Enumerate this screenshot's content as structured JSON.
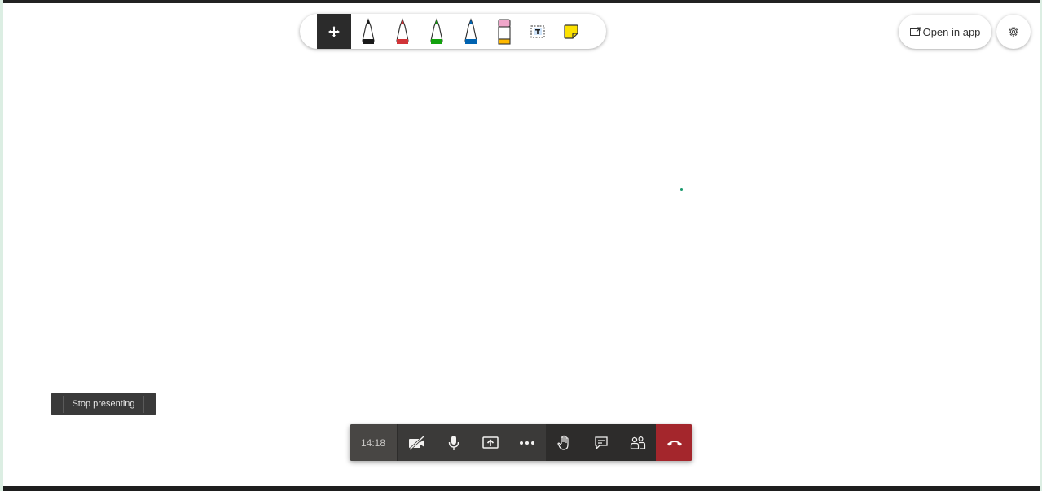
{
  "toolbar": {
    "tools": [
      {
        "name": "move-tool",
        "icon": "move-arrows-icon",
        "active": true
      },
      {
        "name": "black-pen",
        "icon": "pen-icon",
        "color": "#1a1a1a"
      },
      {
        "name": "red-pen",
        "icon": "pen-icon",
        "color": "#d13438"
      },
      {
        "name": "green-pen",
        "icon": "pen-icon",
        "color": "#13a10e"
      },
      {
        "name": "blue-pen",
        "icon": "pen-icon",
        "color": "#0063b1"
      },
      {
        "name": "highlighter",
        "icon": "highlighter-icon",
        "color": "#ffb900"
      },
      {
        "name": "text-tool",
        "icon": "text-box-icon"
      },
      {
        "name": "sticky-note",
        "icon": "sticky-note-icon",
        "color": "#fce100"
      }
    ]
  },
  "open_in_app": {
    "label": "Open in app",
    "icon": "open-external-icon"
  },
  "settings": {
    "icon": "gear-icon"
  },
  "stop_presenting": {
    "label": "Stop presenting"
  },
  "controls": {
    "timer": "14:18",
    "buttons": [
      "camera-off-icon",
      "microphone-icon",
      "share-screen-icon",
      "more-icon",
      "raise-hand-icon",
      "chat-icon",
      "participants-icon",
      "hang-up-icon"
    ],
    "hangup_color": "#a4262c"
  }
}
